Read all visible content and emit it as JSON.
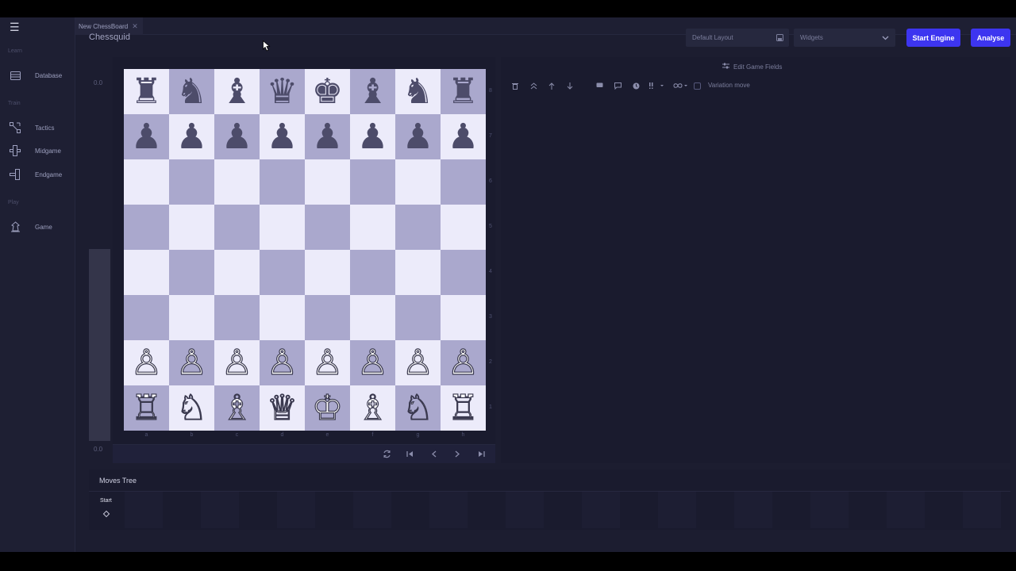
{
  "tab": {
    "title": "New ChessBoard",
    "close": "✕"
  },
  "sidebar": {
    "menu_icon": "☰",
    "sections": [
      {
        "label": "Learn",
        "items": [
          {
            "label": "Database",
            "icon": "database-icon"
          }
        ]
      },
      {
        "label": "Train",
        "items": [
          {
            "label": "Tactics",
            "icon": "tactics-icon"
          },
          {
            "label": "Midgame",
            "icon": "midgame-icon"
          },
          {
            "label": "Endgame",
            "icon": "endgame-icon"
          }
        ]
      },
      {
        "label": "Play",
        "items": [
          {
            "label": "Game",
            "icon": "game-icon"
          }
        ]
      }
    ]
  },
  "header": {
    "app_name": "Chessquid",
    "layout_select": "Default Layout",
    "widgets_select": "Widgets",
    "start_engine": "Start Engine",
    "analyse": "Analyse"
  },
  "eval": {
    "top": "0.0",
    "bottom": "0.0"
  },
  "board": {
    "ranks": [
      "8",
      "7",
      "6",
      "5",
      "4",
      "3",
      "2",
      "1"
    ],
    "files": [
      "a",
      "b",
      "c",
      "d",
      "e",
      "f",
      "g",
      "h"
    ],
    "rows": [
      [
        "♜",
        "♞",
        "♝",
        "♛",
        "♚",
        "♝",
        "♞",
        "♜"
      ],
      [
        "♟",
        "♟",
        "♟",
        "♟",
        "♟",
        "♟",
        "♟",
        "♟"
      ],
      [
        "",
        "",
        "",
        "",
        "",
        "",
        "",
        ""
      ],
      [
        "",
        "",
        "",
        "",
        "",
        "",
        "",
        ""
      ],
      [
        "",
        "",
        "",
        "",
        "",
        "",
        "",
        ""
      ],
      [
        "",
        "",
        "",
        "",
        "",
        "",
        "",
        ""
      ],
      [
        "♙",
        "♙",
        "♙",
        "♙",
        "♙",
        "♙",
        "♙",
        "♙"
      ],
      [
        "♖",
        "♘",
        "♗",
        "♕",
        "♔",
        "♗",
        "♘",
        "♖"
      ]
    ],
    "colors": {
      "light": "#ecebfa",
      "dark": "#aaa8cd"
    }
  },
  "right_panel": {
    "edit_fields": "Edit Game Fields",
    "variation_label": "Variation move"
  },
  "moves_tree": {
    "title": "Moves Tree",
    "start": "Start"
  },
  "colors": {
    "accent": "#3d35f0",
    "background": "#1c1d30"
  }
}
